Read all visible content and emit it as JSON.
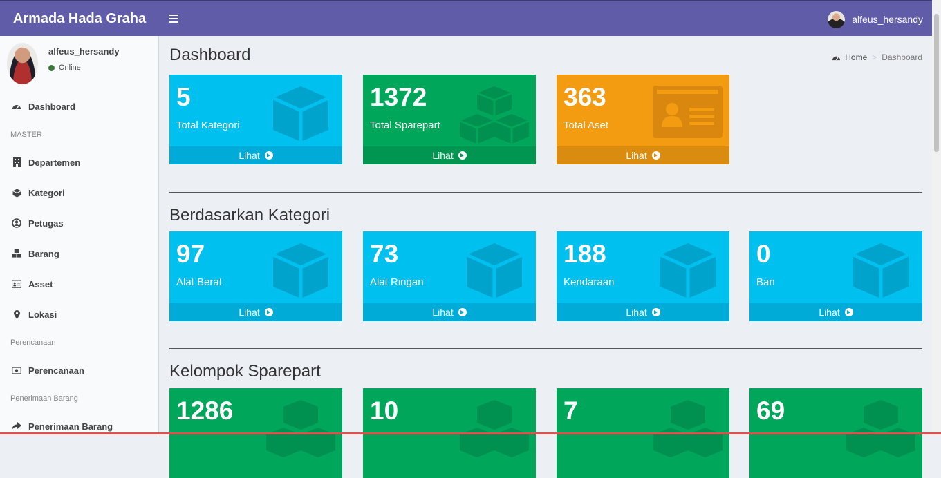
{
  "app": {
    "brand": "Armada Hada Graha",
    "user_name": "alfeus_hersandy",
    "user_status": "Online"
  },
  "sidebar": {
    "dashboard": "Dashboard",
    "header_master": "MASTER",
    "departemen": "Departemen",
    "kategori": "Kategori",
    "petugas": "Petugas",
    "barang": "Barang",
    "asset": "Asset",
    "lokasi": "Lokasi",
    "header_perencanaan": "Perencanaan",
    "perencanaan": "Perencanaan",
    "header_penerimaan": "Penerimaan Barang",
    "penerimaan": "Penerimaan Barang"
  },
  "page": {
    "title": "Dashboard",
    "breadcrumb_home": "Home",
    "breadcrumb_current": "Dashboard",
    "section_kategori": "Berdasarkan Kategori",
    "section_sparepart": "Kelompok Sparepart",
    "link_label": "Lihat"
  },
  "summary": [
    {
      "value": "5",
      "label": "Total Kategori"
    },
    {
      "value": "1372",
      "label": "Total Sparepart"
    },
    {
      "value": "363",
      "label": "Total Aset"
    }
  ],
  "kategori": [
    {
      "value": "97",
      "label": "Alat Berat"
    },
    {
      "value": "73",
      "label": "Alat Ringan"
    },
    {
      "value": "188",
      "label": "Kendaraan"
    },
    {
      "value": "0",
      "label": "Ban"
    }
  ],
  "sparepart": [
    {
      "value": "1286"
    },
    {
      "value": "10"
    },
    {
      "value": "7"
    },
    {
      "value": "69"
    }
  ],
  "colors": {
    "header": "#605ca8",
    "aqua": "#00c0ef",
    "green": "#00a65a",
    "orange": "#f39c12"
  }
}
